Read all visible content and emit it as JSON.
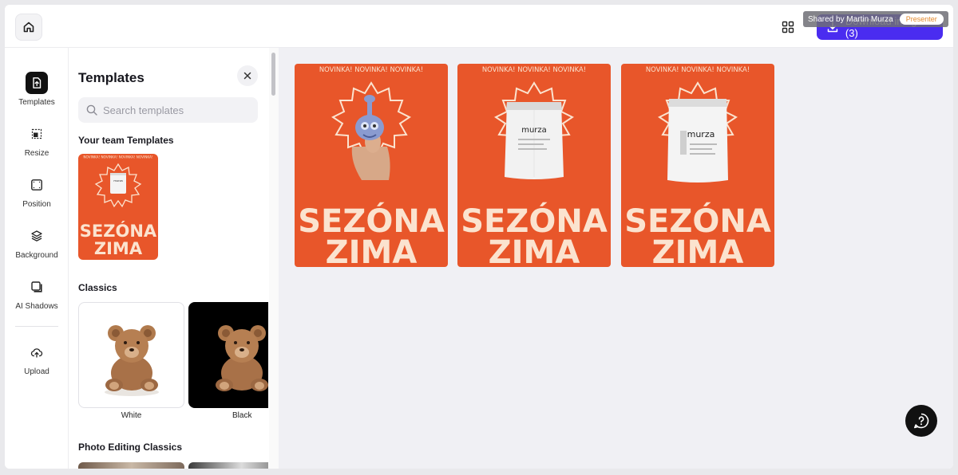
{
  "topbar": {
    "download_label": "Download images (3)",
    "shared_by": "Shared by Martin Murza",
    "presenter": "Presenter",
    "icons": {
      "home": "home-icon",
      "grid": "grid-view-icon",
      "download": "download-icon"
    }
  },
  "rail": {
    "items": [
      {
        "label": "Templates",
        "icon": "templates-icon",
        "active": true
      },
      {
        "label": "Resize",
        "icon": "resize-icon",
        "active": false
      },
      {
        "label": "Position",
        "icon": "position-icon",
        "active": false
      },
      {
        "label": "Background",
        "icon": "layers-icon",
        "active": false
      },
      {
        "label": "AI Shadows",
        "icon": "shadow-icon",
        "active": false
      },
      {
        "label": "Upload",
        "icon": "upload-icon",
        "active": false
      }
    ]
  },
  "panel": {
    "title": "Templates",
    "search_placeholder": "Search templates",
    "team_section": "Your team Templates",
    "team_template": {
      "banner": "NOVINKA! NOVINKA! NOVINKA! NOVINKA!",
      "line1": "SEZÓNA",
      "line2": "ZIMA",
      "bag_text": "murza"
    },
    "classics_section": "Classics",
    "classics": [
      {
        "label": "White"
      },
      {
        "label": "Black"
      }
    ],
    "photo_section": "Photo Editing Classics"
  },
  "canvas": {
    "designs": [
      {
        "banner": "NOVINKA! NOVINKA! NOVINKA!",
        "line1": "SEZÓNA",
        "line2": "ZIMA",
        "product": "toy"
      },
      {
        "banner": "NOVINKA! NOVINKA! NOVINKA!",
        "line1": "SEZÓNA",
        "line2": "ZIMA",
        "product": "bag",
        "bag_text": "murza"
      },
      {
        "banner": "NOVINKA! NOVINKA! NOVINKA!",
        "line1": "SEZÓNA",
        "line2": "ZIMA",
        "product": "bag",
        "bag_text": "murza"
      }
    ]
  },
  "colors": {
    "accent": "#4a2cf0",
    "poster_orange": "#e8562a",
    "poster_text": "#fbe3cf"
  }
}
